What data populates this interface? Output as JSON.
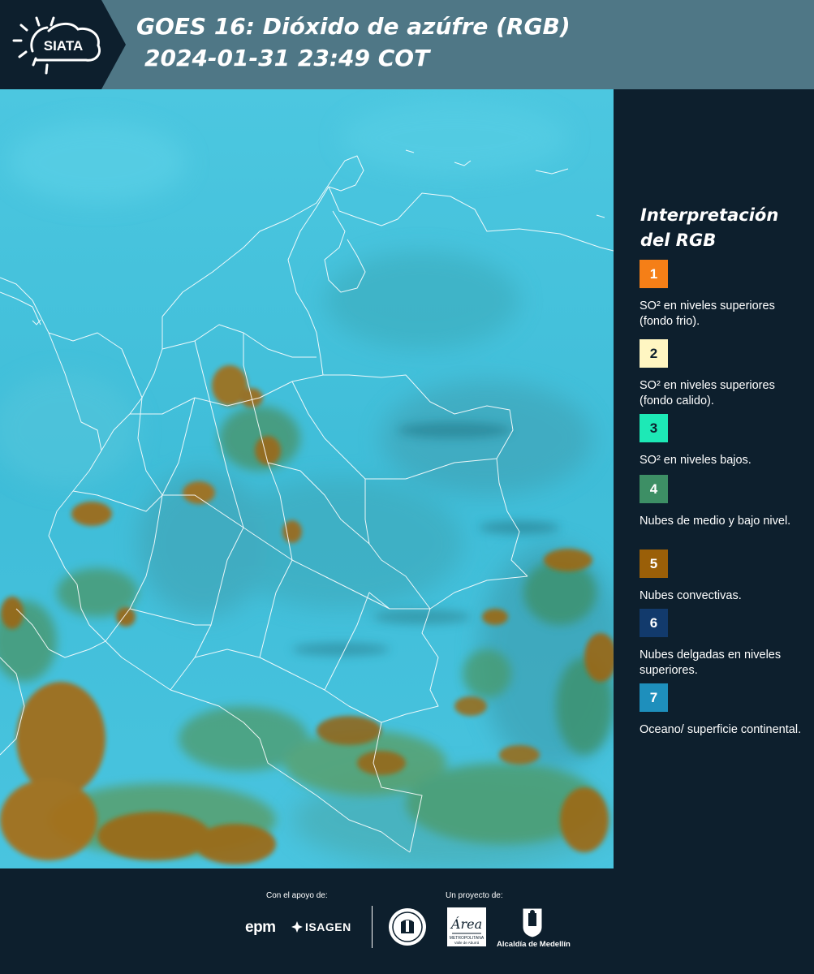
{
  "header": {
    "logo_text": "SIATA",
    "title_line1": "GOES 16: Dióxido de azúfre (RGB)",
    "title_line2": "2024-01-31 23:49 COT",
    "background": "#4f7786"
  },
  "map": {
    "product": "SO2 RGB satellite composite",
    "base_color": "#45c3dc",
    "boundary_color": "#ffffff"
  },
  "legend": {
    "title": "Interpretación del RGB",
    "items": [
      {
        "number": "1",
        "color": "#f57f17",
        "num_color": "#ffffff",
        "label": "SO² en niveles superiores (fondo frio)."
      },
      {
        "number": "2",
        "color": "#fff6c2",
        "num_color": "#0d1f2d",
        "label": "SO² en niveles superiores (fondo calido)."
      },
      {
        "number": "3",
        "color": "#1de9b6",
        "num_color": "#0d1f2d",
        "label": "SO² en niveles bajos."
      },
      {
        "number": "4",
        "color": "#3d8f65",
        "num_color": "#ffffff",
        "label": "Nubes de medio y bajo nivel."
      },
      {
        "number": "5",
        "color": "#9a5f08",
        "num_color": "#ffffff",
        "label": "Nubes convectivas."
      },
      {
        "number": "6",
        "color": "#123a6c",
        "num_color": "#ffffff",
        "label": "Nubes delgadas en niveles superiores."
      },
      {
        "number": "7",
        "color": "#1e8fbc",
        "num_color": "#ffffff",
        "label": "Oceano/ superficie continental."
      }
    ]
  },
  "footer": {
    "support_label": "Con el apoyo de:",
    "project_label": "Un proyecto de:",
    "sponsors": [
      "epm",
      "ISAGEN"
    ],
    "partners": [
      "Área Metropolitana Valle de Aburrá",
      "Alcaldía de Medellín"
    ],
    "area_logo_text": "Área",
    "area_logo_sub1": "METROPOLITANA",
    "area_logo_sub2": "Valle de Aburrá",
    "alcaldia_label": "Alcaldía de Medellín"
  }
}
